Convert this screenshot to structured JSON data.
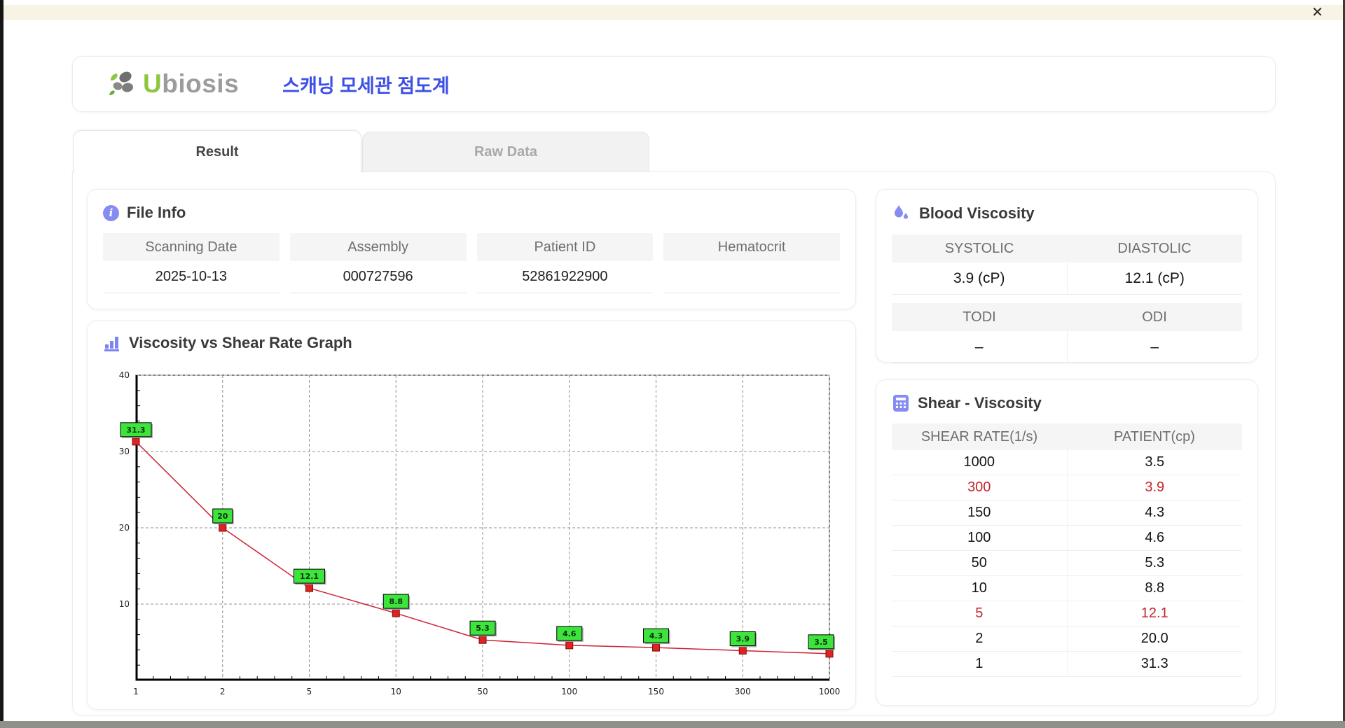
{
  "window": {
    "close_label": "✕"
  },
  "header": {
    "logo_first_letter": "U",
    "logo_rest": "biosis",
    "app_title": "스캐닝 모세관 점도계"
  },
  "tabs": [
    {
      "label": "Result",
      "active": true
    },
    {
      "label": "Raw Data",
      "active": false
    }
  ],
  "file_info": {
    "title": "File Info",
    "fields": [
      {
        "label": "Scanning Date",
        "value": "2025-10-13"
      },
      {
        "label": "Assembly",
        "value": "000727596"
      },
      {
        "label": "Patient ID",
        "value": "52861922900"
      },
      {
        "label": "Hematocrit",
        "value": ""
      }
    ]
  },
  "blood_viscosity": {
    "title": "Blood Viscosity",
    "sections": [
      {
        "col1": {
          "label": "SYSTOLIC",
          "value": "3.9 (cP)"
        },
        "col2": {
          "label": "DIASTOLIC",
          "value": "12.1 (cP)"
        }
      },
      {
        "col1": {
          "label": "TODI",
          "value": "–"
        },
        "col2": {
          "label": "ODI",
          "value": "–"
        }
      }
    ]
  },
  "graph": {
    "title": "Viscosity vs Shear Rate Graph"
  },
  "chart_data": {
    "type": "line",
    "title": "Viscosity vs Shear Rate Graph",
    "x_categories": [
      1,
      2,
      5,
      10,
      50,
      100,
      150,
      300,
      1000
    ],
    "values": [
      31.3,
      20,
      12.1,
      8.8,
      5.3,
      4.6,
      4.3,
      3.9,
      3.5
    ],
    "point_labels": [
      "31.3",
      "20",
      "12.1",
      "8.8",
      "5.3",
      "4.6",
      "4.3",
      "3.9",
      "3.5"
    ],
    "xlabel": "",
    "ylabel": "",
    "ylim": [
      0,
      40
    ],
    "y_ticks": [
      10,
      20,
      30,
      40
    ],
    "x_axis_scale": "category",
    "grid": "dashed",
    "legend": "none",
    "line_color": "#cc2233",
    "marker_color": "#e02222",
    "label_bg": "#3ce43c"
  },
  "shear_viscosity": {
    "title": "Shear - Viscosity",
    "columns": [
      "SHEAR RATE(1/s)",
      "PATIENT(cp)"
    ],
    "rows": [
      {
        "rate": "1000",
        "patient": "3.5",
        "highlight": false
      },
      {
        "rate": "300",
        "patient": "3.9",
        "highlight": true
      },
      {
        "rate": "150",
        "patient": "4.3",
        "highlight": false
      },
      {
        "rate": "100",
        "patient": "4.6",
        "highlight": false
      },
      {
        "rate": "50",
        "patient": "5.3",
        "highlight": false
      },
      {
        "rate": "10",
        "patient": "8.8",
        "highlight": false
      },
      {
        "rate": "5",
        "patient": "12.1",
        "highlight": true
      },
      {
        "rate": "2",
        "patient": "20.0",
        "highlight": false
      },
      {
        "rate": "1",
        "patient": "31.3",
        "highlight": false
      }
    ]
  },
  "colors": {
    "accent_purple": "#868cf0",
    "title_blue": "#3c4fe6",
    "logo_green": "#8dc63f",
    "highlight_red": "#c1272d",
    "point_label_green": "#3ce43c",
    "titlebar_cream": "#f8f4e5"
  }
}
